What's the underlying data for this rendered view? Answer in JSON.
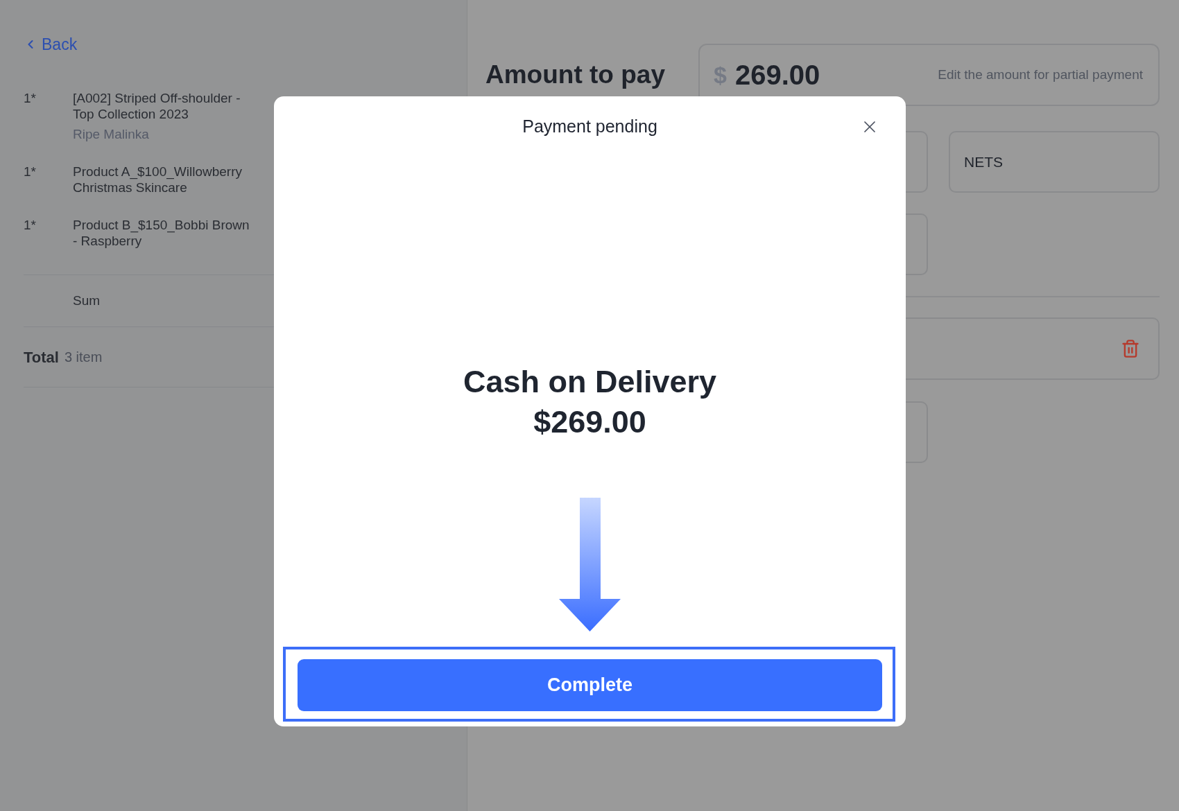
{
  "back_link": {
    "label": "Back"
  },
  "order_items": [
    {
      "quantity": "1*",
      "name_lines": [
        "[A002] Striped Off-shoulder -",
        "Top Collection 2023"
      ],
      "variant": "Ripe Malinka"
    },
    {
      "quantity": "1*",
      "name_lines": [
        "Product A_$100_Willowberry",
        "Christmas Skincare"
      ]
    },
    {
      "quantity": "1*",
      "name_lines": [
        "Product B_$150_Bobbi Brown",
        "- Raspberry"
      ]
    }
  ],
  "sum": {
    "label": "Sum"
  },
  "total": {
    "label": "Total",
    "count": "3 item"
  },
  "amount_to_pay": {
    "title": "Amount to pay",
    "currency": "$",
    "value": "269.00",
    "hint": "Edit the amount for partial payment"
  },
  "payment_methods": [
    {
      "label": "NETS"
    }
  ],
  "dialog": {
    "title": "Payment pending",
    "method": "Cash on Delivery",
    "amount": "$269.00",
    "button": "Complete"
  }
}
